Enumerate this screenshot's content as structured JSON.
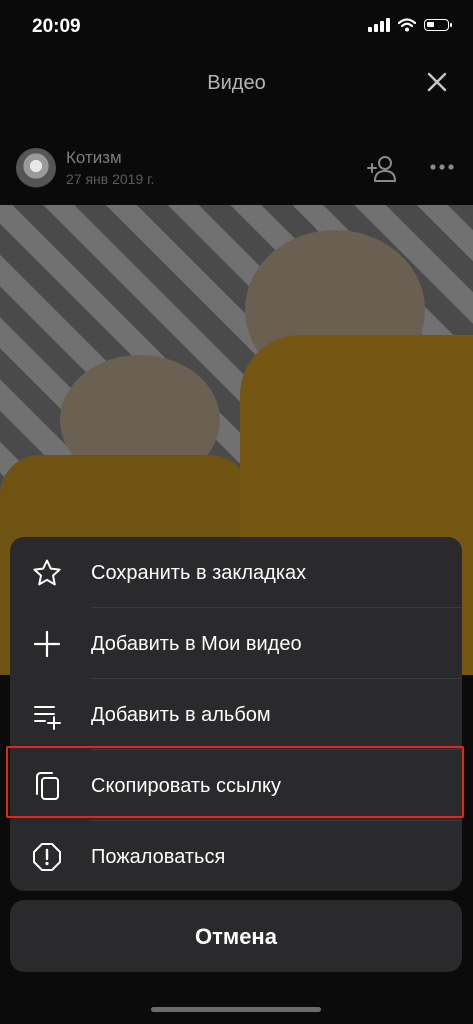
{
  "status_bar": {
    "time": "20:09",
    "signal_icon": "signal-bars-icon",
    "wifi_icon": "wifi-icon",
    "battery_icon": "battery-icon",
    "battery_level": 0.3
  },
  "header": {
    "title": "Видео",
    "close_icon": "close-icon"
  },
  "post": {
    "author": "Котизм",
    "date": "27 янв 2019 г.",
    "avatar_icon": "avatar",
    "add_friend_icon": "add-friend-icon",
    "more_icon": "more-icon"
  },
  "action_sheet": {
    "items": [
      {
        "label": "Сохранить в закладках",
        "icon": "star-icon"
      },
      {
        "label": "Добавить в Мои видео",
        "icon": "plus-icon"
      },
      {
        "label": "Добавить в альбом",
        "icon": "add-to-playlist-icon"
      },
      {
        "label": "Скопировать ссылку",
        "icon": "copy-icon"
      },
      {
        "label": "Пожаловаться",
        "icon": "report-icon"
      }
    ],
    "cancel_label": "Отмена"
  },
  "colors": {
    "sheet_background": "#2a2a2c",
    "highlight": "#e3251d",
    "background": "#0a0a0a"
  }
}
